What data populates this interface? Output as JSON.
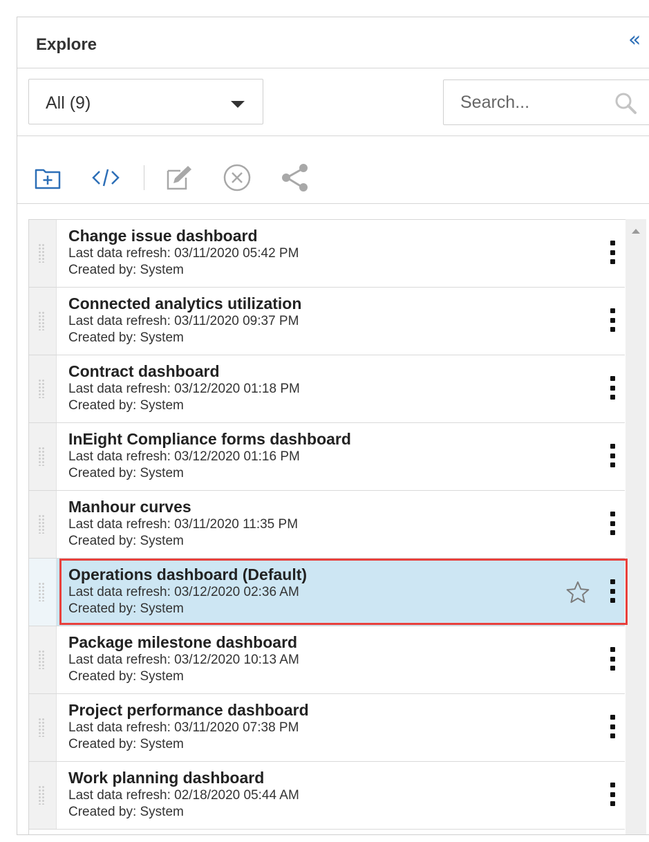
{
  "header": {
    "title": "Explore",
    "collapse_icon": "double-chevron-left-icon"
  },
  "filter": {
    "selected": "All (9)",
    "icon": "caret-down-icon"
  },
  "search": {
    "placeholder": "Search...",
    "value": "",
    "icon": "search-icon"
  },
  "toolbar": {
    "icons": [
      "add-folder-icon",
      "code-icon",
      "edit-icon",
      "delete-icon",
      "share-icon"
    ]
  },
  "colors": {
    "accent": "#2d6fb7",
    "selected_row": "#cde6f3",
    "highlight": "#e8403c"
  },
  "items": [
    {
      "title": "Change issue dashboard",
      "refresh": "Last data refresh: 03/11/2020 05:42 PM",
      "created": "Created by: System"
    },
    {
      "title": "Connected analytics utilization",
      "refresh": "Last data refresh: 03/11/2020 09:37 PM",
      "created": "Created by: System"
    },
    {
      "title": "Contract dashboard",
      "refresh": "Last data refresh: 03/12/2020 01:18 PM",
      "created": "Created by: System"
    },
    {
      "title": "InEight Compliance forms dashboard",
      "refresh": "Last data refresh: 03/12/2020 01:16 PM",
      "created": "Created by: System"
    },
    {
      "title": "Manhour curves",
      "refresh": "Last data refresh: 03/11/2020 11:35 PM",
      "created": "Created by: System"
    },
    {
      "title": "Operations dashboard (Default)",
      "refresh": "Last data refresh: 03/12/2020 02:36 AM",
      "created": "Created by: System"
    },
    {
      "title": "Package milestone dashboard",
      "refresh": "Last data refresh: 03/12/2020 10:13 AM",
      "created": "Created by: System"
    },
    {
      "title": "Project performance dashboard",
      "refresh": "Last data refresh: 03/11/2020 07:38 PM",
      "created": "Created by: System"
    },
    {
      "title": "Work planning dashboard",
      "refresh": "Last data refresh: 02/18/2020 05:44 AM",
      "created": "Created by: System"
    }
  ]
}
